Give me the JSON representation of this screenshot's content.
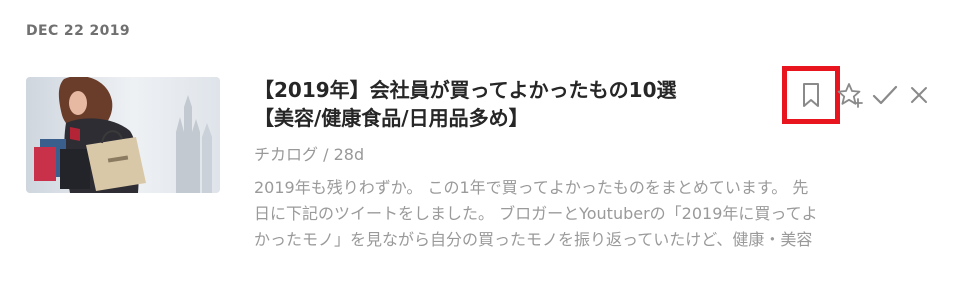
{
  "date_header": "DEC 22 2019",
  "entry": {
    "title_lines": [
      "【2019年】会社員が買ってよかったもの10選",
      "【美容/健康食品/日用品多め】"
    ],
    "source": "チカログ",
    "separator": "/",
    "age": "28d",
    "summary_lines": [
      "2019年も残りわずか。 この1年で買ってよかったものをまとめています。 先",
      "日に下記のツイートをしました。 ブロガーとYoutuberの「2019年に買ってよ",
      "かったモノ」を見ながら自分の買ったモノを振り返っていたけど、健康・美容"
    ],
    "actions": {
      "save": "bookmark-icon",
      "favorite": "star-plus-icon",
      "mark_read": "checkmark-icon",
      "hide": "close-icon"
    }
  },
  "colors": {
    "highlight": "#e8141e",
    "icon": "#888888",
    "title": "#262626",
    "muted": "#999999"
  }
}
